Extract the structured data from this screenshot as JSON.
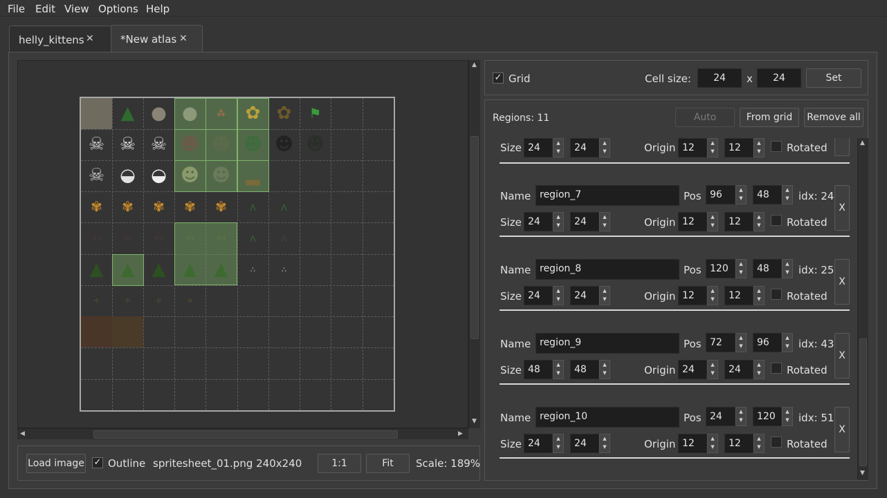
{
  "menu": [
    "File",
    "Edit",
    "View",
    "Options",
    "Help"
  ],
  "tabs": [
    {
      "label": "helly_kittens"
    },
    {
      "label": "*New atlas"
    }
  ],
  "grid": {
    "label": "Grid",
    "checked": true,
    "cell_size_label": "Cell size:",
    "cell_w": "24",
    "times": "x",
    "cell_h": "24",
    "set_label": "Set"
  },
  "regions_header": {
    "count_text": "Regions: 11",
    "auto_label": "Auto",
    "from_grid_label": "From grid",
    "remove_all_label": "Remove all"
  },
  "region_labels": {
    "name": "Name",
    "pos": "Pos",
    "size": "Size",
    "origin": "Origin",
    "rotated": "Rotated",
    "delete": "X"
  },
  "partial_region": {
    "size_w": "24",
    "size_h": "24",
    "origin_x": "12",
    "origin_y": "12"
  },
  "regions": [
    {
      "name": "region_7",
      "pos_x": "96",
      "pos_y": "48",
      "idx": "idx: 24",
      "size_w": "24",
      "size_h": "24",
      "origin_x": "12",
      "origin_y": "12"
    },
    {
      "name": "region_8",
      "pos_x": "120",
      "pos_y": "48",
      "idx": "idx: 25",
      "size_w": "24",
      "size_h": "24",
      "origin_x": "12",
      "origin_y": "12"
    },
    {
      "name": "region_9",
      "pos_x": "72",
      "pos_y": "96",
      "idx": "idx: 43",
      "size_w": "48",
      "size_h": "48",
      "origin_x": "24",
      "origin_y": "24"
    },
    {
      "name": "region_10",
      "pos_x": "24",
      "pos_y": "120",
      "idx": "idx: 51",
      "size_w": "24",
      "size_h": "24",
      "origin_x": "12",
      "origin_y": "12"
    }
  ],
  "bottom": {
    "load_label": "Load image",
    "outline_label": "Outline",
    "outline_checked": true,
    "file_info": "spritesheet_01.png 240x240",
    "one_to_one": "1:1",
    "fit": "Fit",
    "scale": "Scale: 189%"
  },
  "colors": {
    "region_fill": "#78aa64",
    "region_border": "#7fb46c",
    "field_bg": "#1e1e1e",
    "window_bg": "#353535"
  }
}
